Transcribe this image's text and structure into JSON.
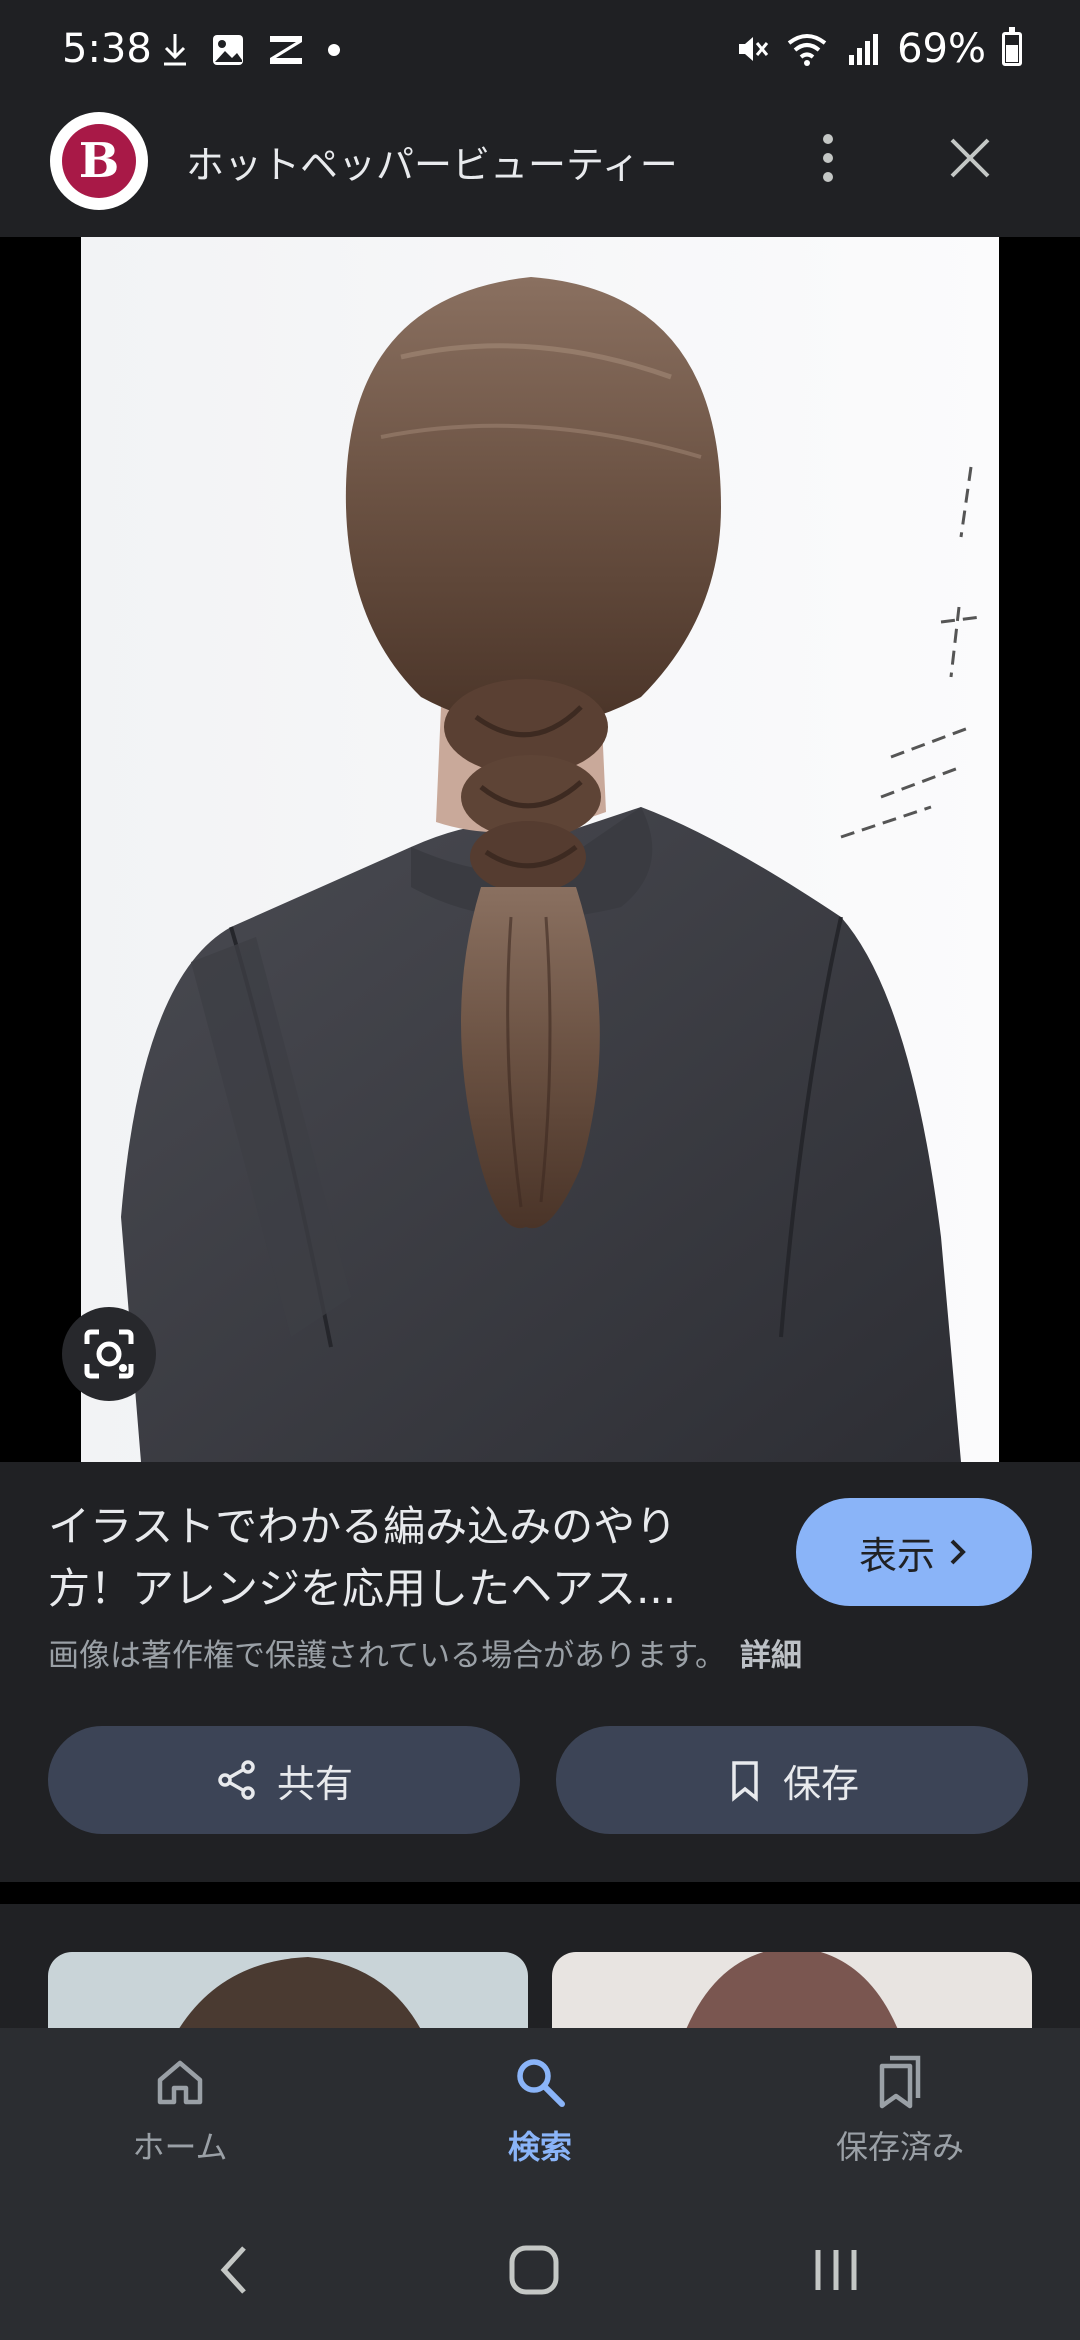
{
  "status_bar": {
    "time": "5:38",
    "battery_percent": "69%"
  },
  "header": {
    "site_logo_letter": "B",
    "site_title": "ホットペッパービューティー"
  },
  "result": {
    "title_line1": "イラストでわかる編み込みのやり",
    "title_line2": "方！アレンジを応用したヘアス...",
    "visit_label": "表示",
    "copyright_notice": "画像は著作権で保護されている場合があります。",
    "details_link": "詳細",
    "share_label": "共有",
    "save_label": "保存"
  },
  "bottom_nav": {
    "items": [
      {
        "label": "ホーム",
        "icon": "home-icon",
        "active": false
      },
      {
        "label": "検索",
        "icon": "search-icon",
        "active": true
      },
      {
        "label": "保存済み",
        "icon": "saved-icon",
        "active": false
      }
    ]
  },
  "colors": {
    "background": "#202124",
    "accent": "#8ab4f8",
    "button": "#3c4456",
    "logo": "#a81947"
  }
}
